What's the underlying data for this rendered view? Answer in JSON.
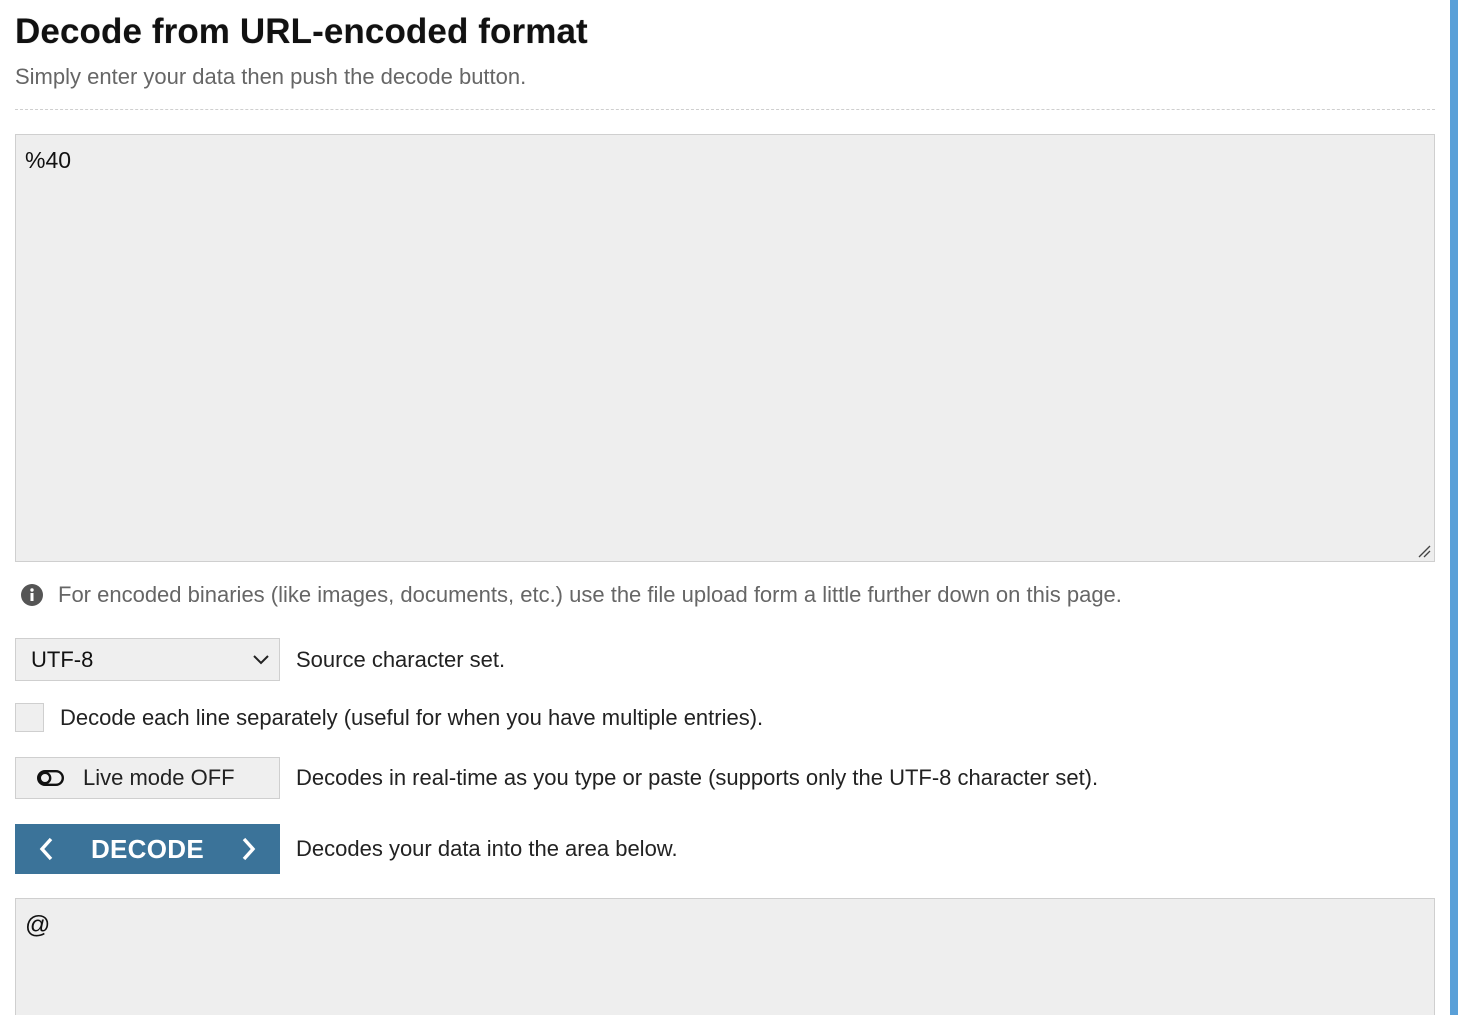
{
  "header": {
    "title": "Decode from URL-encoded format",
    "subtitle": "Simply enter your data then push the decode button."
  },
  "input": {
    "value": "%40"
  },
  "note": {
    "icon": "info-icon",
    "text": "For encoded binaries (like images, documents, etc.) use the file upload form a little further down on this page."
  },
  "charset": {
    "selected": "UTF-8",
    "label": "Source character set."
  },
  "line_option": {
    "checked": false,
    "label": "Decode each line separately (useful for when you have multiple entries)."
  },
  "live_mode": {
    "button_label": "Live mode OFF",
    "icon": "toggle-off-icon",
    "description": "Decodes in real-time as you type or paste (supports only the UTF-8 character set)."
  },
  "decode": {
    "button_label": "DECODE",
    "description": "Decodes your data into the area below."
  },
  "output": {
    "value": "@"
  },
  "colors": {
    "accent": "#3b7399",
    "side_bar": "#5aa0d8",
    "field_bg": "#eeeeee"
  }
}
